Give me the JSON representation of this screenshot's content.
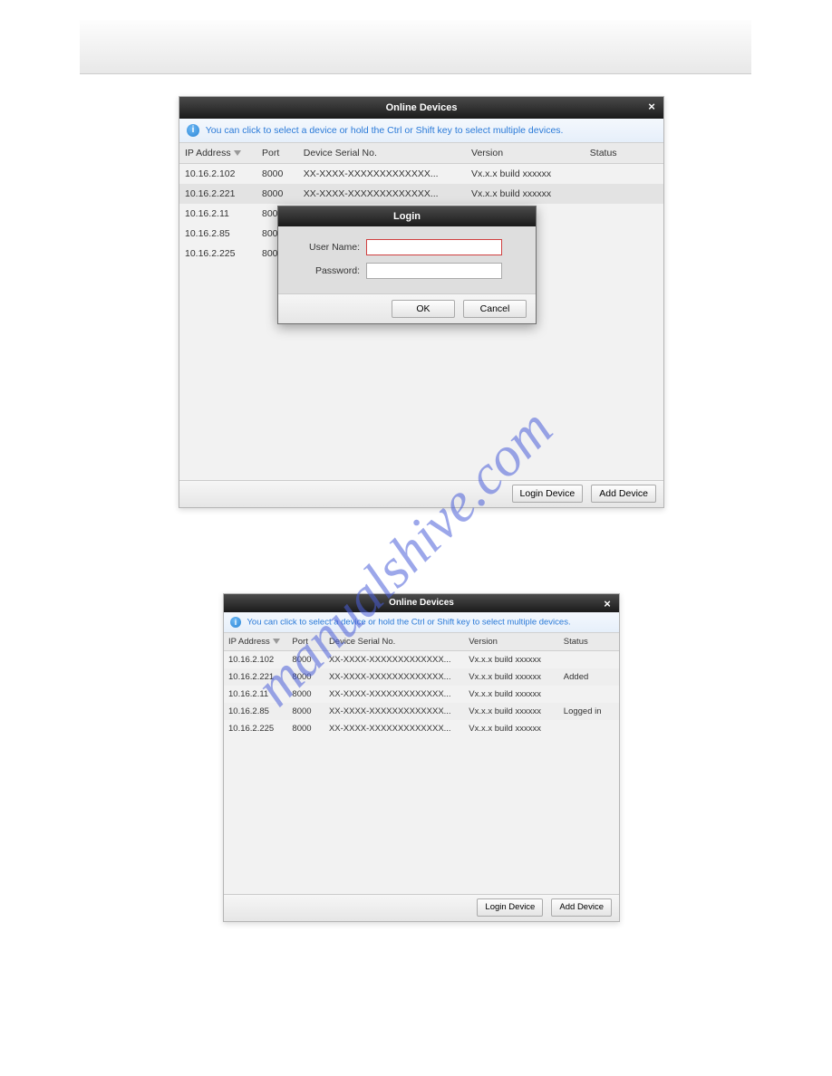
{
  "watermark_text": "manualshive.com",
  "fig1": {
    "title": "Online Devices",
    "close_label": "×",
    "hint": "You can click to select a device or hold the Ctrl or Shift key to select multiple devices.",
    "headers": {
      "ip": "IP Address",
      "port": "Port",
      "serial": "Device Serial No.",
      "version": "Version",
      "status": "Status"
    },
    "rows": [
      {
        "ip": "10.16.2.102",
        "port": "8000",
        "serial": "XX-XXXX-XXXXXXXXXXXXX...",
        "version": "Vx.x.x build xxxxxx",
        "status": ""
      },
      {
        "ip": "10.16.2.221",
        "port": "8000",
        "serial": "XX-XXXX-XXXXXXXXXXXXX...",
        "version": "Vx.x.x build xxxxxx",
        "status": ""
      },
      {
        "ip": "10.16.2.11",
        "port": "8000",
        "serial": "",
        "version": "",
        "status": ""
      },
      {
        "ip": "10.16.2.85",
        "port": "8000",
        "serial": "",
        "version": "",
        "status": ""
      },
      {
        "ip": "10.16.2.225",
        "port": "8000",
        "serial": "",
        "version": "",
        "status": ""
      }
    ],
    "login_btn": "Login Device",
    "add_btn": "Add Device",
    "login_dialog": {
      "title": "Login",
      "user_label": "User Name:",
      "pass_label": "Password:",
      "user_val": "",
      "pass_val": "",
      "ok": "OK",
      "cancel": "Cancel"
    }
  },
  "fig2": {
    "title": "Online Devices",
    "close_label": "×",
    "hint": "You can click to select a device or hold the Ctrl or Shift key to select multiple devices.",
    "headers": {
      "ip": "IP Address",
      "port": "Port",
      "serial": "Device Serial No.",
      "version": "Version",
      "status": "Status"
    },
    "rows": [
      {
        "ip": "10.16.2.102",
        "port": "8000",
        "serial": "XX-XXXX-XXXXXXXXXXXXX...",
        "version": "Vx.x.x build xxxxxx",
        "status": ""
      },
      {
        "ip": "10.16.2.221",
        "port": "8000",
        "serial": "XX-XXXX-XXXXXXXXXXXXX...",
        "version": "Vx.x.x build xxxxxx",
        "status": "Added"
      },
      {
        "ip": "10.16.2.11",
        "port": "8000",
        "serial": "XX-XXXX-XXXXXXXXXXXXX...",
        "version": "Vx.x.x build xxxxxx",
        "status": ""
      },
      {
        "ip": "10.16.2.85",
        "port": "8000",
        "serial": "XX-XXXX-XXXXXXXXXXXXX...",
        "version": "Vx.x.x build xxxxxx",
        "status": "Logged in"
      },
      {
        "ip": "10.16.2.225",
        "port": "8000",
        "serial": "XX-XXXX-XXXXXXXXXXXXX...",
        "version": "Vx.x.x build xxxxxx",
        "status": ""
      }
    ],
    "login_btn": "Login Device",
    "add_btn": "Add Device"
  }
}
